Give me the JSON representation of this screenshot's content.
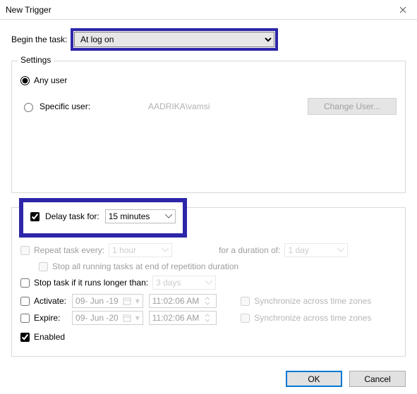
{
  "window": {
    "title": "New Trigger"
  },
  "begin": {
    "label": "Begin the task:",
    "selected": "At log on"
  },
  "settings": {
    "legend": "Settings",
    "any_user_label": "Any user",
    "specific_user_label": "Specific user:",
    "specific_user_value": "AADRIKA\\vamsi",
    "change_user_label": "Change User..."
  },
  "advanced": {
    "delay": {
      "label": "Delay task for:",
      "value": "15 minutes"
    },
    "repeat": {
      "label": "Repeat task every:",
      "value": "1 hour",
      "duration_label": "for a duration of:",
      "duration_value": "1 day"
    },
    "stop_all_label": "Stop all running tasks at end of repetition duration",
    "stop_if": {
      "label": "Stop task if it runs longer than:",
      "value": "3 days"
    },
    "activate": {
      "label": "Activate:",
      "date": "09- Jun -19",
      "time": "11:02:06 AM",
      "sync_label": "Synchronize across time zones"
    },
    "expire": {
      "label": "Expire:",
      "date": "09- Jun -20",
      "time": "11:02:06 AM",
      "sync_label": "Synchronize across time zones"
    },
    "enabled_label": "Enabled"
  },
  "footer": {
    "ok": "OK",
    "cancel": "Cancel"
  }
}
